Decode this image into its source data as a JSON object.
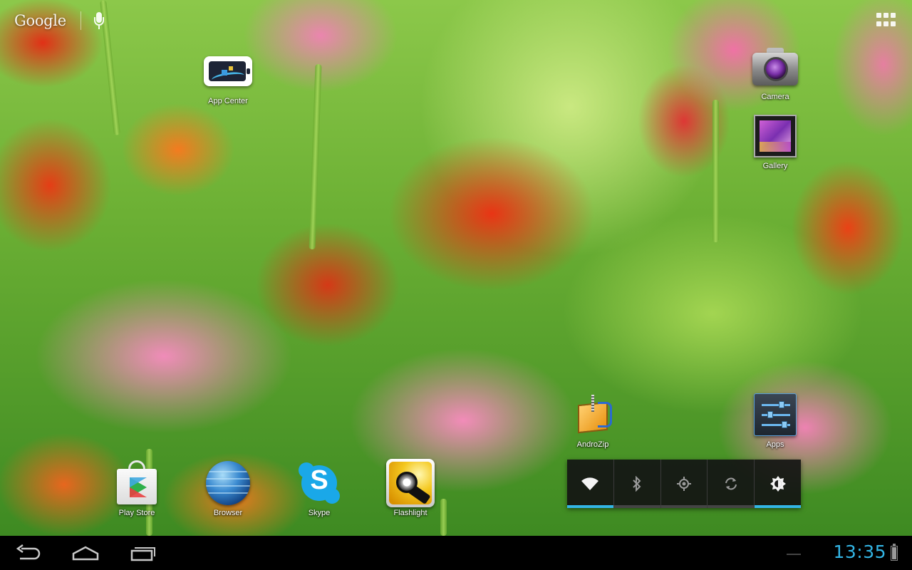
{
  "search": {
    "logo_text": "Google",
    "mic_icon": "mic-icon"
  },
  "all_apps_icon": "apps-grid-icon",
  "shortcuts": {
    "app_center": {
      "label": "App Center",
      "icon": "app-center-icon"
    },
    "camera": {
      "label": "Camera",
      "icon": "camera-icon"
    },
    "gallery": {
      "label": "Gallery",
      "icon": "gallery-icon"
    },
    "androzip": {
      "label": "AndroZip",
      "icon": "androzip-icon"
    },
    "apps": {
      "label": "Apps",
      "icon": "settings-sliders-icon"
    },
    "play_store": {
      "label": "Play Store",
      "icon": "play-store-icon"
    },
    "browser": {
      "label": "Browser",
      "icon": "globe-icon"
    },
    "skype": {
      "label": "Skype",
      "icon": "skype-icon",
      "glyph": "S"
    },
    "flashlight": {
      "label": "Flashlight",
      "icon": "flashlight-icon"
    }
  },
  "power_widget": {
    "wifi": {
      "icon": "wifi-icon",
      "on": true
    },
    "bluetooth": {
      "icon": "bluetooth-icon",
      "on": false
    },
    "gps": {
      "icon": "gps-icon",
      "on": false
    },
    "sync": {
      "icon": "sync-icon",
      "on": false
    },
    "brightness": {
      "icon": "brightness-icon",
      "on": true
    }
  },
  "system_bar": {
    "back_icon": "back-icon",
    "home_icon": "home-icon",
    "recents_icon": "recent-apps-icon",
    "time": "13:35",
    "battery_icon": "battery-icon"
  },
  "colors": {
    "accent": "#33b5e5",
    "system_bar": "#000000"
  }
}
